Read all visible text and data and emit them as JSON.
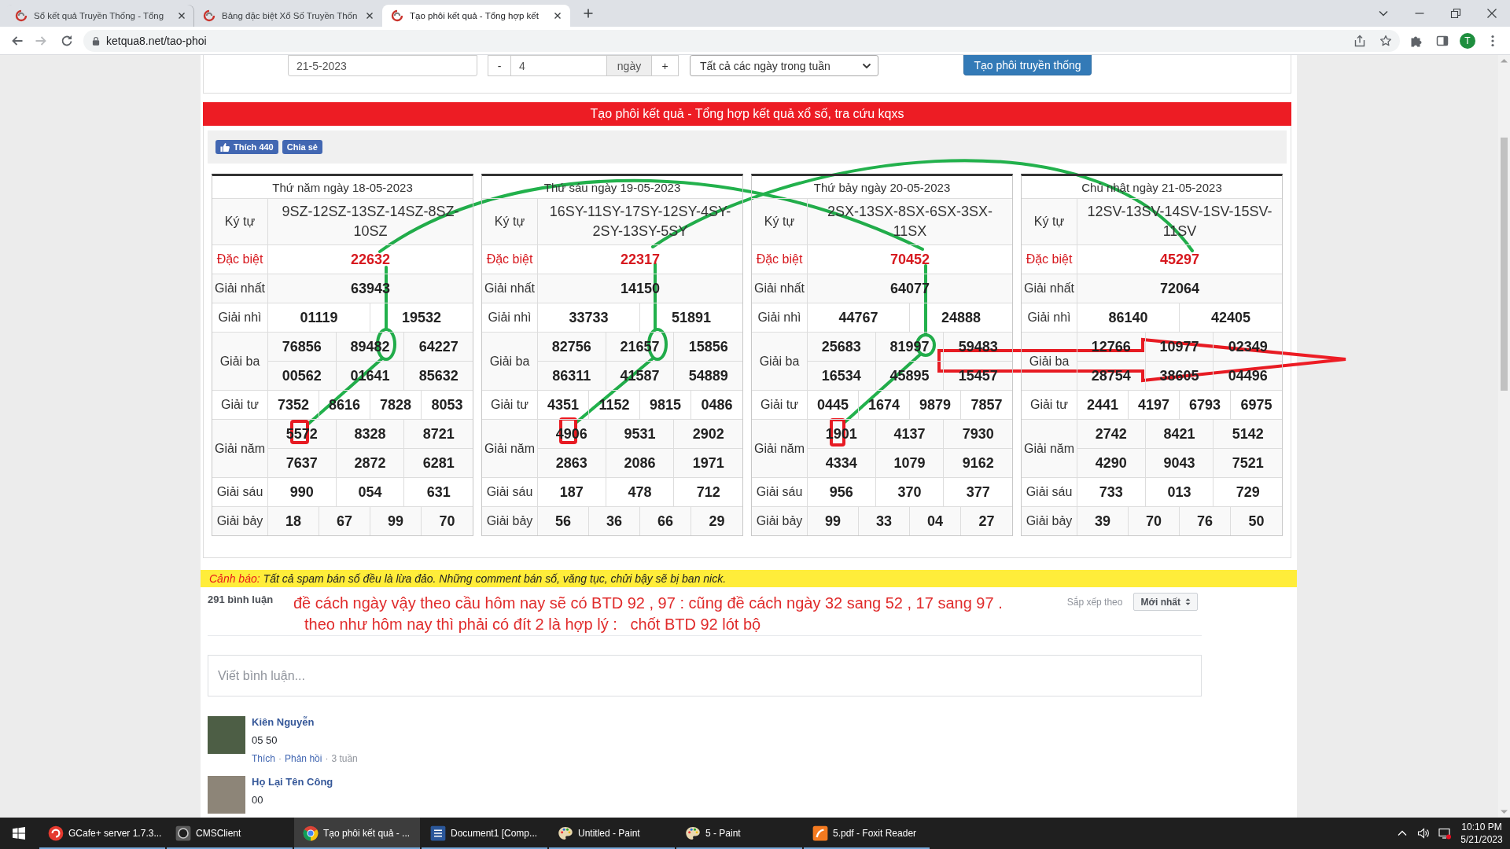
{
  "browser": {
    "tabs": [
      {
        "title": "Sổ kết quả Truyền Thống - Tổng",
        "selected": false
      },
      {
        "title": "Bảng đặc biệt Xổ Số Truyền Thốn",
        "selected": false
      },
      {
        "title": "Tạo phôi kết quả - Tổng hợp kết",
        "selected": true
      }
    ],
    "url": "ketqua8.net/tao-phoi",
    "profile": "T"
  },
  "form": {
    "date": "21-5-2023",
    "minus": "-",
    "days": "4",
    "days_unit": "ngày",
    "plus": "+",
    "weekday_select": "Tất cả các ngày trong tuần",
    "submit": "Tạo phôi truyền thống"
  },
  "banner": "Tạo phôi kết quả - Tổng hợp kết quả xổ số, tra cứu kqxs",
  "social": {
    "like": "Thích 440",
    "share": "Chia sẻ"
  },
  "results": [
    {
      "date": "Thứ năm ngày 18-05-2023",
      "rows": [
        {
          "label": "Ký tự",
          "kind": "code",
          "values": [
            "9SZ-12SZ-13SZ-14SZ-8SZ-10SZ"
          ]
        },
        {
          "label": "Đặc biệt",
          "kind": "special",
          "values": [
            "22632"
          ]
        },
        {
          "label": "Giải nhất",
          "kind": "prize",
          "values": [
            "63943"
          ]
        },
        {
          "label": "Giải nhì",
          "kind": "prize",
          "values": [
            "01119",
            "19532"
          ]
        },
        {
          "label": "Giải ba",
          "kind": "prize",
          "values": [
            "76856",
            "89482",
            "64227",
            "00562",
            "01641",
            "85632"
          ]
        },
        {
          "label": "Giải tư",
          "kind": "prize",
          "values": [
            "7352",
            "8616",
            "7828",
            "8053"
          ]
        },
        {
          "label": "Giải năm",
          "kind": "prize",
          "values": [
            "5572",
            "8328",
            "8721",
            "7637",
            "2872",
            "6281"
          ]
        },
        {
          "label": "Giải sáu",
          "kind": "prize",
          "values": [
            "990",
            "054",
            "631"
          ]
        },
        {
          "label": "Giải bảy",
          "kind": "prize",
          "values": [
            "18",
            "67",
            "99",
            "70"
          ]
        }
      ]
    },
    {
      "date": "Thứ sáu ngày 19-05-2023",
      "rows": [
        {
          "label": "Ký tự",
          "kind": "code",
          "values": [
            "16SY-11SY-17SY-12SY-4SY-2SY-13SY-5SY"
          ]
        },
        {
          "label": "Đặc biệt",
          "kind": "special",
          "values": [
            "22317"
          ]
        },
        {
          "label": "Giải nhất",
          "kind": "prize",
          "values": [
            "14150"
          ]
        },
        {
          "label": "Giải nhì",
          "kind": "prize",
          "values": [
            "33733",
            "51891"
          ]
        },
        {
          "label": "Giải ba",
          "kind": "prize",
          "values": [
            "82756",
            "21657",
            "15856",
            "86311",
            "41587",
            "54889"
          ]
        },
        {
          "label": "Giải tư",
          "kind": "prize",
          "values": [
            "4351",
            "1152",
            "9815",
            "0486"
          ]
        },
        {
          "label": "Giải năm",
          "kind": "prize",
          "values": [
            "4906",
            "9531",
            "2902",
            "2863",
            "2086",
            "1971"
          ]
        },
        {
          "label": "Giải sáu",
          "kind": "prize",
          "values": [
            "187",
            "478",
            "712"
          ]
        },
        {
          "label": "Giải bảy",
          "kind": "prize",
          "values": [
            "56",
            "36",
            "66",
            "29"
          ]
        }
      ]
    },
    {
      "date": "Thứ bảy ngày 20-05-2023",
      "rows": [
        {
          "label": "Ký tự",
          "kind": "code",
          "values": [
            "2SX-13SX-8SX-6SX-3SX-11SX"
          ]
        },
        {
          "label": "Đặc biệt",
          "kind": "special",
          "values": [
            "70452"
          ]
        },
        {
          "label": "Giải nhất",
          "kind": "prize",
          "values": [
            "64077"
          ]
        },
        {
          "label": "Giải nhì",
          "kind": "prize",
          "values": [
            "44767",
            "24888"
          ]
        },
        {
          "label": "Giải ba",
          "kind": "prize",
          "values": [
            "25683",
            "81997",
            "59483",
            "16534",
            "45895",
            "15457"
          ]
        },
        {
          "label": "Giải tư",
          "kind": "prize",
          "values": [
            "0445",
            "1674",
            "9879",
            "7857"
          ]
        },
        {
          "label": "Giải năm",
          "kind": "prize",
          "values": [
            "1901",
            "4137",
            "7930",
            "4334",
            "1079",
            "9162"
          ]
        },
        {
          "label": "Giải sáu",
          "kind": "prize",
          "values": [
            "956",
            "370",
            "377"
          ]
        },
        {
          "label": "Giải bảy",
          "kind": "prize",
          "values": [
            "99",
            "33",
            "04",
            "27"
          ]
        }
      ]
    },
    {
      "date": "Chủ nhật ngày 21-05-2023",
      "rows": [
        {
          "label": "Ký tự",
          "kind": "code",
          "values": [
            "12SV-13SV-14SV-1SV-15SV-11SV"
          ]
        },
        {
          "label": "Đặc biệt",
          "kind": "special",
          "values": [
            "45297"
          ]
        },
        {
          "label": "Giải nhất",
          "kind": "prize",
          "values": [
            "72064"
          ]
        },
        {
          "label": "Giải nhì",
          "kind": "prize",
          "values": [
            "86140",
            "42405"
          ]
        },
        {
          "label": "Giải ba",
          "kind": "prize",
          "values": [
            "12766",
            "10977",
            "02349",
            "28754",
            "38605",
            "04496"
          ]
        },
        {
          "label": "Giải tư",
          "kind": "prize",
          "values": [
            "2441",
            "4197",
            "6793",
            "6975"
          ]
        },
        {
          "label": "Giải năm",
          "kind": "prize",
          "values": [
            "2742",
            "8421",
            "5142",
            "4290",
            "9043",
            "7521"
          ]
        },
        {
          "label": "Giải sáu",
          "kind": "prize",
          "values": [
            "733",
            "013",
            "729"
          ]
        },
        {
          "label": "Giải bảy",
          "kind": "prize",
          "values": [
            "39",
            "70",
            "76",
            "50"
          ]
        }
      ]
    }
  ],
  "warning": {
    "label": "Cảnh báo:",
    "text": "Tất cả spam bán số đều là lừa đảo. Những comment bán số, văng tục, chửi bậy sẽ bị ban nick."
  },
  "comments": {
    "count": "291 bình luận",
    "note": [
      "đề cách ngày vậy theo cầu hôm nay sẽ có BTD 92 , 97 : cũng đề cách ngày 32 sang 52 , 17 sang 97 .",
      "theo như hôm nay thì phải có đít 2 là hợp lý :   chốt BTD 92 lót bộ"
    ],
    "sort_label": "Sắp xếp theo",
    "sort_value": "Mới nhất",
    "placeholder": "Viết bình luận...",
    "items": [
      {
        "author": "Kiên Nguyễn",
        "text": "05 50",
        "actions": [
          {
            "kind": "link",
            "label": "Thích"
          },
          {
            "kind": "dot",
            "label": "·"
          },
          {
            "kind": "link",
            "label": "Phản hồi"
          },
          {
            "kind": "dot",
            "label": "·"
          },
          {
            "kind": "time",
            "label": "3 tuần"
          }
        ]
      },
      {
        "author": "Họ Lại Tên Công",
        "text": "00"
      }
    ]
  },
  "taskbar": {
    "items": [
      {
        "kind": "gcafe",
        "label": "GCafe+ server 1.7.3...",
        "selected": false
      },
      {
        "kind": "client",
        "label": "CMSClient",
        "selected": false
      },
      {
        "kind": "browser",
        "label": "Tạo phôi kết quả - ...",
        "selected": true
      },
      {
        "kind": "word",
        "label": "Document1 [Comp...",
        "selected": false
      },
      {
        "kind": "paint",
        "label": "Untitled - Paint",
        "selected": false
      },
      {
        "kind": "paint",
        "label": "5 - Paint",
        "selected": false
      },
      {
        "kind": "reader",
        "label": "5.pdf - Foxit Reader",
        "selected": false
      }
    ],
    "time": "10:10 PM",
    "date": "5/21/2023"
  }
}
